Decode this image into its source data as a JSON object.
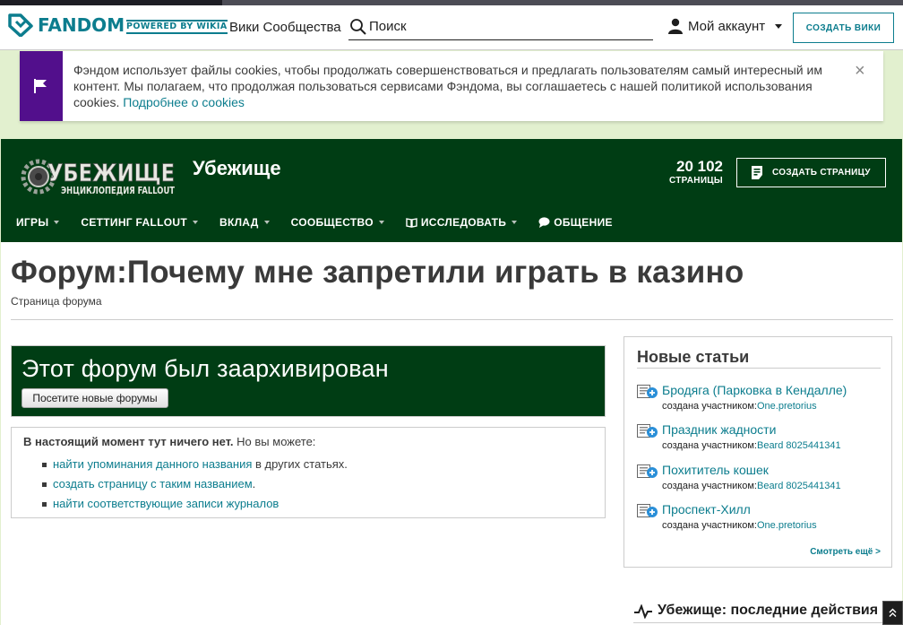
{
  "global_nav": {
    "brand": "FANDOM",
    "powered": "POWERED BY WIKIA",
    "communities_link": "Вики Сообщества",
    "search_placeholder": "Поиск",
    "account_label": "Мой аккаунт",
    "create_wiki": "СОЗДАТЬ ВИКИ",
    "brand_color": "#0c7d8e"
  },
  "cookie_banner": {
    "text": "Фэндом использует файлы cookies, чтобы продолжать совершенствоваться и предлагать пользователям самый интересный им контент. Мы полагаем, что продолжая пользоваться сервисами Фэндома, вы соглашаетесь с нашей политикой использования cookies.",
    "link": "Подробнее о cookies",
    "close": "×",
    "accent": "#520f8c"
  },
  "community": {
    "wordmark_line1": "УБЕЖИЩЕ",
    "wordmark_line2": "ЭНЦИКЛОПЕДИЯ FALLOUT",
    "name": "Убежище",
    "pages_count": "20 102",
    "pages_label": "СТРАНИЦЫ",
    "create_page": "СОЗДАТЬ СТРАНИЦУ",
    "header_color": "#003d14",
    "nav": [
      "ИГРЫ",
      "СЕТТИНГ FALLOUT",
      "ВКЛАД",
      "СООБЩЕСТВО",
      "ИССЛЕДОВАТЬ",
      "ОБЩЕНИЕ"
    ]
  },
  "article": {
    "title": "Форум:Почему мне запретили играть в казино",
    "subtitle": "Страница форума",
    "archive_heading": "Этот форум был заархивирован",
    "archive_button": "Посетите новые форумы",
    "noarticle_bold": "В настоящий момент тут ничего нет.",
    "noarticle_rest": " Но вы можете:",
    "options": [
      {
        "link": "найти упоминания данного названия",
        "rest": " в других статьях."
      },
      {
        "link": "создать страницу с таким названием",
        "rest": "."
      },
      {
        "link": "найти соответствующие записи журналов",
        "rest": ""
      }
    ]
  },
  "rail": {
    "heading": "Новые статьи",
    "by_prefix": "создана участником:",
    "articles": [
      {
        "title": "Бродяга (Парковка в Кендалле)",
        "user": "One.pretorius"
      },
      {
        "title": "Праздник жадности",
        "user": "Beard 8025441341"
      },
      {
        "title": "Похититель кошек",
        "user": "Beard 8025441341"
      },
      {
        "title": "Проспект-Хилл",
        "user": "One.pretorius"
      }
    ],
    "more": "Смотреть ещё >",
    "activity_heading": "Убежище: последние действия"
  }
}
